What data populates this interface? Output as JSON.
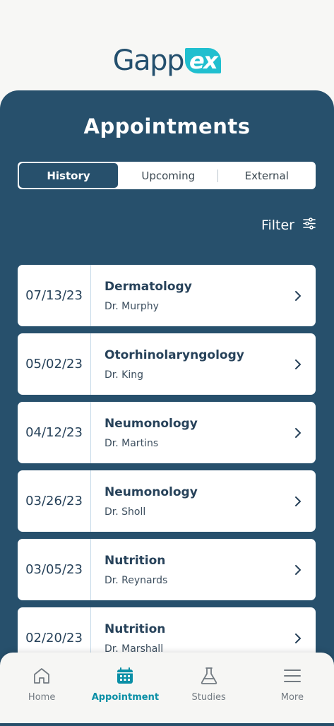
{
  "brand": {
    "logo_main": "Gapp",
    "logo_accent": "ex"
  },
  "page": {
    "title": "Appointments"
  },
  "tabs": [
    {
      "label": "History",
      "active": true
    },
    {
      "label": "Upcoming",
      "active": false
    },
    {
      "label": "External",
      "active": false
    }
  ],
  "filter": {
    "label": "Filter",
    "icon": "sliders-icon"
  },
  "appointments": [
    {
      "date": "07/13/23",
      "specialty": "Dermatology",
      "doctor": "Dr. Murphy"
    },
    {
      "date": "05/02/23",
      "specialty": "Otorhinolaryngology",
      "doctor": "Dr. King"
    },
    {
      "date": "04/12/23",
      "specialty": "Neumonology",
      "doctor": "Dr. Martins"
    },
    {
      "date": "03/26/23",
      "specialty": "Neumonology",
      "doctor": "Dr. Sholl"
    },
    {
      "date": "03/05/23",
      "specialty": "Nutrition",
      "doctor": "Dr. Reynards"
    },
    {
      "date": "02/20/23",
      "specialty": "Nutrition",
      "doctor": "Dr. Marshall"
    }
  ],
  "nav": [
    {
      "label": "Home",
      "icon": "home-icon",
      "active": false
    },
    {
      "label": "Appointment",
      "icon": "calendar-icon",
      "active": true
    },
    {
      "label": "Studies",
      "icon": "flask-icon",
      "active": false
    },
    {
      "label": "More",
      "icon": "menu-icon",
      "active": false
    }
  ],
  "colors": {
    "primary": "#27506c",
    "accent": "#20bfcf",
    "nav_active": "#0a8fa6",
    "background": "#f7f7f5"
  }
}
